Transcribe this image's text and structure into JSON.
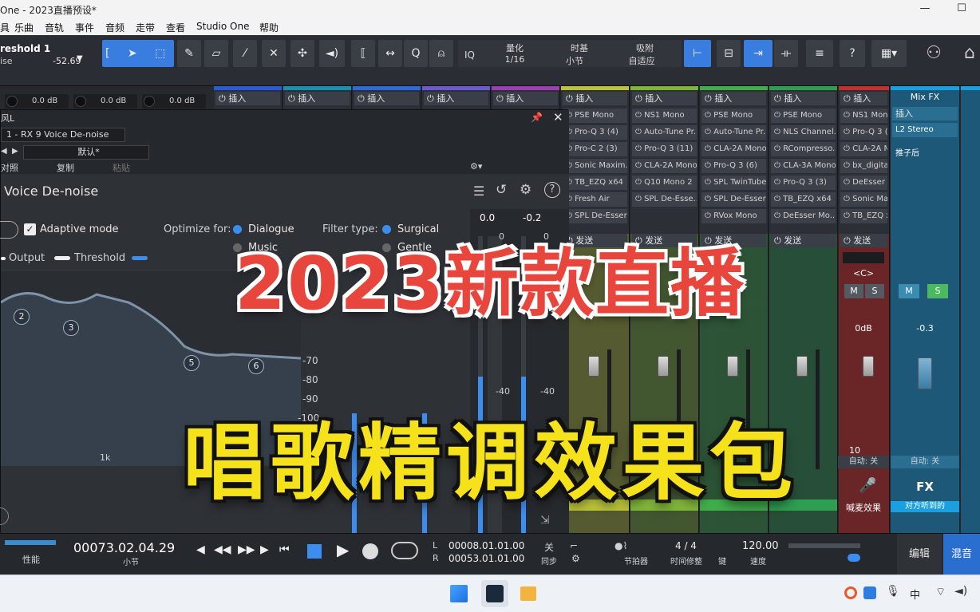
{
  "window": {
    "title": "One - 2023直播预设*",
    "minimize": "—",
    "maximize": "☐"
  },
  "menu": [
    "具",
    "乐曲",
    "音轨",
    "事件",
    "音频",
    "走带",
    "查看",
    "Studio One",
    "帮助"
  ],
  "toolbar": {
    "track_name": "reshold 1",
    "track_sub": "ise",
    "track_value": "-52.69",
    "iq": "IQ",
    "quantize_label": "量化",
    "quantize_value": "1/16",
    "timebase_label": "时基",
    "timebase_value": "小节",
    "snap_label": "吸附",
    "snap_value": "自适应",
    "help": "?"
  },
  "gain_readouts": [
    "0.0 dB",
    "0.0 dB",
    "0.0 dB"
  ],
  "insert_label": "插入",
  "send_label": "发送",
  "channels": [
    {
      "color": "#2a5bd7",
      "inserts": []
    },
    {
      "color": "#1a8fb0",
      "inserts": []
    },
    {
      "color": "#2d6ad8",
      "inserts": []
    },
    {
      "color": "#6a5ad0",
      "inserts": []
    },
    {
      "color": "#9b3fb2",
      "inserts": []
    },
    {
      "color": "#b9c23a",
      "inserts": [
        "PSE Mono",
        "Pro-Q 3 (4)",
        "Pro-C 2 (3)",
        "Sonic Maxim...",
        "TB_EZQ x64",
        "Fresh Air",
        "SPL De-Esser"
      ]
    },
    {
      "color": "#7fb43a",
      "inserts": [
        "NS1 Mono",
        "Auto-Tune Pr...",
        "Pro-Q 3 (11)",
        "CLA-2A Mono",
        "Q10 Mono 2",
        "SPL De-Esse..."
      ]
    },
    {
      "color": "#3fae4a",
      "inserts": [
        "PSE Mono",
        "Auto-Tune Pr...",
        "CLA-2A Mono",
        "Pro-Q 3 (6)",
        "SPL TwinTube",
        "SPL De-Esser",
        "RVox Mono"
      ]
    },
    {
      "color": "#2e9e50",
      "inserts": [
        "PSE Mono",
        "NLS Channel...",
        "RCompresso...",
        "CLA-3A Mono",
        "Pro-Q 3 (3)",
        "TB_EZQ x64",
        "DeEsser Mo..."
      ]
    },
    {
      "color": "#c23030",
      "inserts": [
        "NS1 Mono",
        "Pro-Q 3 (",
        "CLA-2A M",
        "bx_digital",
        "DeEsser I",
        "Sonic Ma",
        "TB_EZQ x"
      ]
    }
  ],
  "mixfx": {
    "title": "Mix FX",
    "insert": "插入",
    "slot": "L2 Stereo",
    "post": "推子后",
    "volume": "-0.3",
    "auto": "自动: 关",
    "name": "FX",
    "sub": "对方听到的"
  },
  "red_channel": {
    "pan": "<C>",
    "db": "0dB",
    "num": "10",
    "auto": "自动: 关",
    "name": "喊麦效果"
  },
  "plugin": {
    "title": "风L",
    "preset_slot": "1 - RX 9 Voice De-noise",
    "preset_default": "默认*",
    "compare": "对照",
    "copy": "复制",
    "paste": "粘贴",
    "name": "Voice De-noise",
    "adaptive": "Adaptive mode",
    "optimize_label": "Optimize for:",
    "opt_dialogue": "Dialogue",
    "opt_music": "Music",
    "filter_label": "Filter type:",
    "filter_surgical": "Surgical",
    "filter_gentle": "Gentle",
    "legend_output": "Output",
    "legend_threshold": "Threshold",
    "meter_left_top": "0.0",
    "meter_right_top": "-0.2",
    "meter_zero_left": "0",
    "meter_zero_right": "0",
    "meter_forty_left": "-40",
    "meter_forty_right": "-40",
    "db_scale": [
      "-70",
      "-80",
      "-90",
      "-100"
    ],
    "nodes": [
      "2",
      "3",
      "5",
      "6"
    ],
    "bottom_tick": "1k"
  },
  "overlay": {
    "line1": "2023新款直播",
    "line2": "唱歌精调效果包"
  },
  "transport": {
    "perf": "性能",
    "time": "00073.02.04.29",
    "time_unit": "小节",
    "loop_l_tag": "L",
    "loop_r_tag": "R",
    "loop_l": "00008.01.01.00",
    "loop_r": "00053.01.01.00",
    "sync_off": "关",
    "sync": "同步",
    "metronome": "节拍器",
    "signature": "4 / 4",
    "timesig": "时间修整",
    "key": "键",
    "tempo": "120.00",
    "tempo_label": "速度",
    "edit": "编辑",
    "mix": "混音"
  },
  "taskbar": {
    "lang": "中"
  }
}
